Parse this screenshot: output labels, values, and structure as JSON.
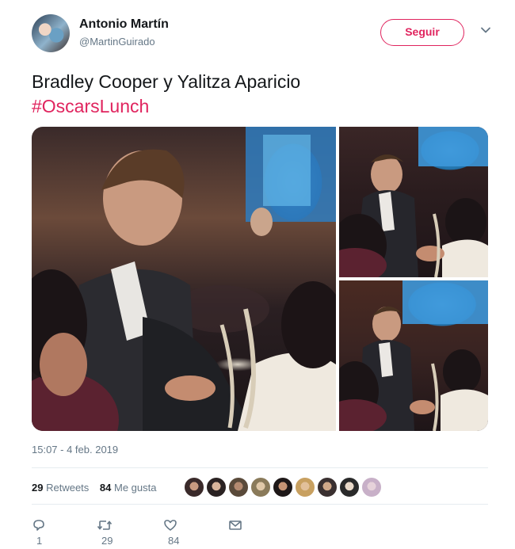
{
  "author": {
    "name": "Antonio Martín",
    "handle": "@MartinGuirado"
  },
  "follow_button": "Seguir",
  "tweet": {
    "text": "Bradley Cooper y Yalitza Aparicio",
    "hashtag": "#OscarsLunch"
  },
  "timestamp": "15:07 - 4 feb. 2019",
  "stats": {
    "retweets_count": "29",
    "retweets_label": "Retweets",
    "likes_count": "84",
    "likes_label": "Me gusta"
  },
  "actions": {
    "reply_count": "1",
    "retweet_count": "29",
    "like_count": "84"
  },
  "colors": {
    "accent": "#e0245e",
    "secondary_text": "#657786"
  },
  "icons": [
    "reply-icon",
    "retweet-icon",
    "heart-icon",
    "message-icon",
    "chevron-down-icon"
  ]
}
